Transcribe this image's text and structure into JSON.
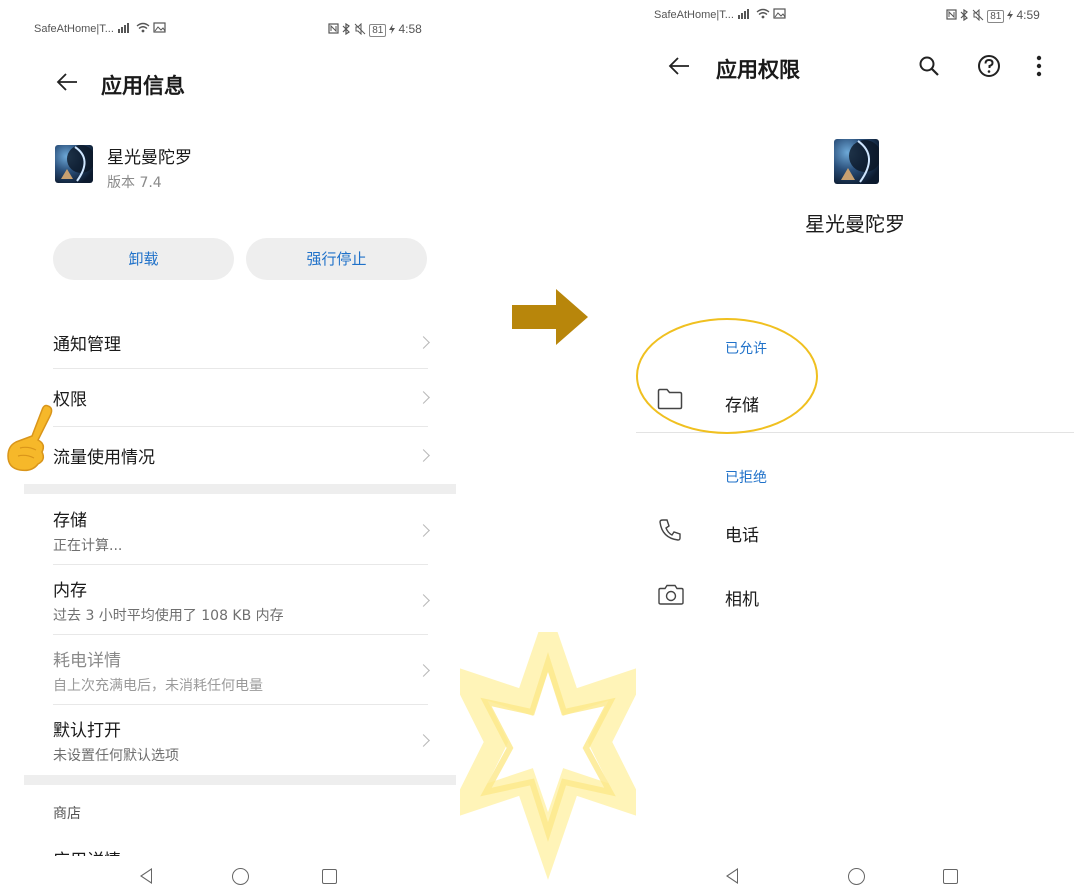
{
  "left": {
    "status_left": "SafeAtHome|T...",
    "status_right": "81",
    "status_time": "4:58",
    "back_icon": "arrow-left-icon",
    "title": "应用信息",
    "app_name": "星光曼陀罗",
    "app_version": "版本 7.4",
    "buttons": {
      "uninstall": "卸载",
      "force_stop": "强行停止"
    },
    "menu": [
      {
        "label": "通知管理"
      },
      {
        "label": "权限"
      },
      {
        "label": "流量使用情况"
      }
    ],
    "details": [
      {
        "label": "存储",
        "sub": "正在计算..."
      },
      {
        "label": "内存",
        "sub": "过去 3 小时平均使用了 108 KB 内存"
      },
      {
        "label": "耗电详情",
        "sub": "自上次充满电后，未消耗任何电量"
      },
      {
        "label": "默认打开",
        "sub": "未设置任何默认选项"
      }
    ],
    "store_header": "商店",
    "store_item": "应用详情"
  },
  "right": {
    "status_left": "SafeAtHome|T...",
    "status_right": "81",
    "status_time": "4:59",
    "title": "应用权限",
    "app_name": "星光曼陀罗",
    "allowed_header": "已允许",
    "allowed": [
      {
        "label": "存储",
        "icon": "folder-icon"
      }
    ],
    "denied_header": "已拒绝",
    "denied": [
      {
        "label": "电话",
        "icon": "phone-icon"
      },
      {
        "label": "相机",
        "icon": "camera-icon"
      }
    ]
  },
  "colors": {
    "accent_blue": "#1f71c9",
    "arrow_gold": "#b8860b",
    "highlight_circle": "#f0c020",
    "hand": "#f6b82a"
  }
}
